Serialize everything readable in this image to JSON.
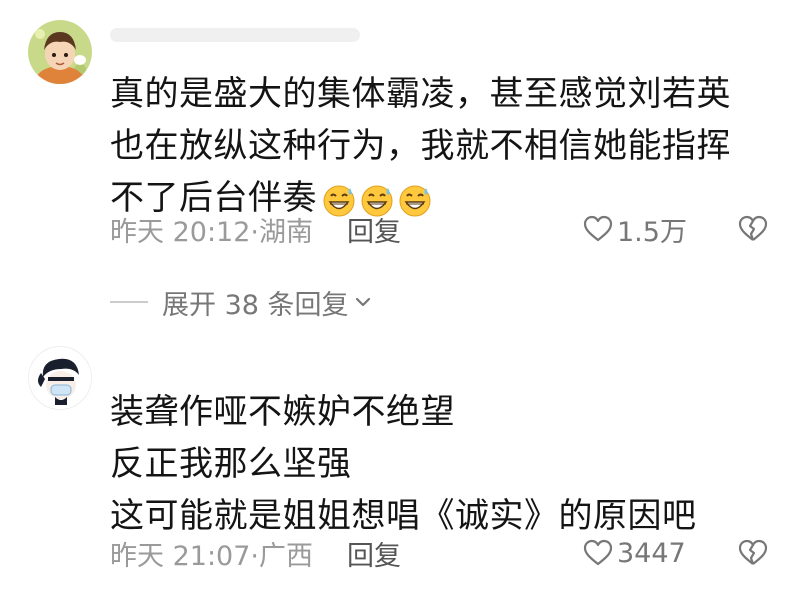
{
  "comments": [
    {
      "lines": [
        "真的是盛大的集体霸凌，甚至感觉刘若英",
        "也在放纵这种行为，我就不相信她能指挥",
        "不了后台伴奏"
      ],
      "emoji": [
        "grin-sweat-emoji",
        "grin-sweat-emoji",
        "grin-sweat-emoji"
      ],
      "time": "昨天 20:12",
      "location": "·湖南",
      "reply_label": "回复",
      "likes": "1.5万"
    },
    {
      "lines": [
        "装聋作哑不嫉妒不绝望",
        "反正我那么坚强",
        "这可能就是姐姐想唱《诚实》的原因吧"
      ],
      "time": "昨天 21:07",
      "location": "·广西",
      "reply_label": "回复",
      "likes": "3447"
    }
  ],
  "expand_replies": "展开 38 条回复",
  "colors": {
    "text": "#141414",
    "meta": "#9a9a9a",
    "reply": "#555555",
    "icon": "#777777"
  }
}
